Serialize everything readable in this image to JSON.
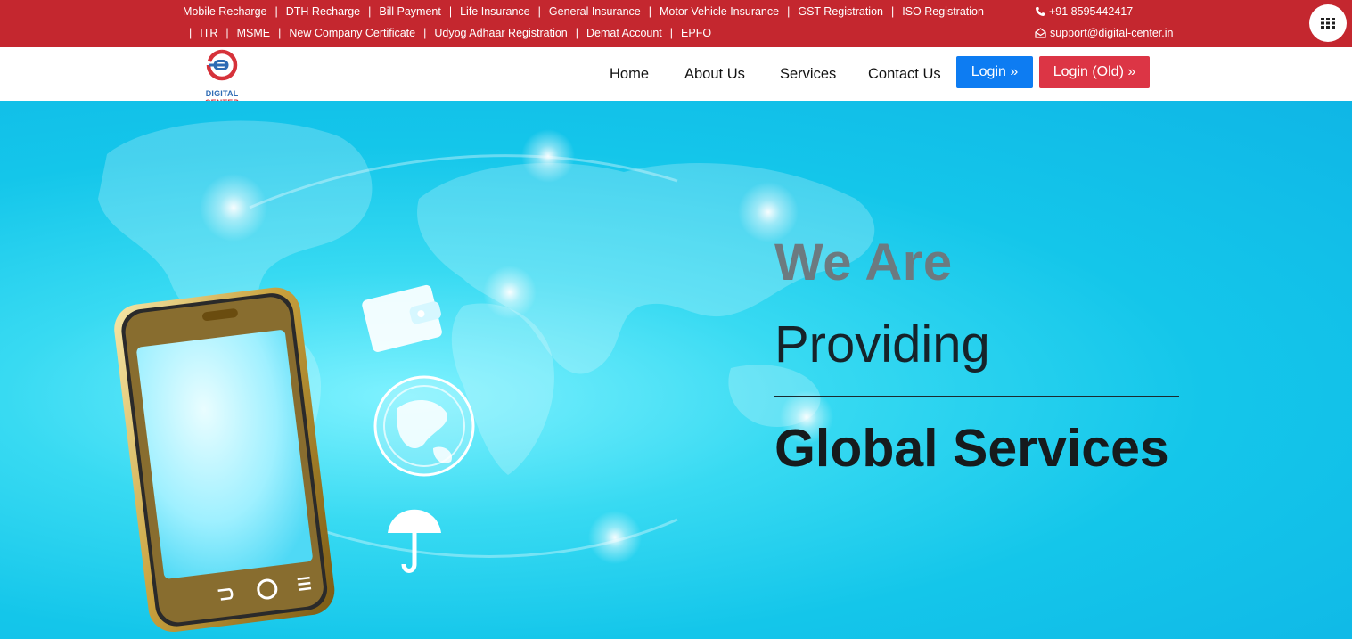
{
  "topbar": {
    "links_row1": [
      "Mobile Recharge",
      "DTH Recharge",
      "Bill Payment",
      "Life Insurance",
      "General Insurance",
      "Motor Vehicle Insurance",
      "GST Registration",
      "ISO Registration"
    ],
    "links_row2": [
      "ITR",
      "MSME",
      "New Company Certificate",
      "Udyog Adhaar Registration",
      "Demat Account",
      "EPFO"
    ],
    "separator": "|",
    "phone": "+91 8595442417",
    "email": "support@digital-center.in",
    "phone_icon": "phone-icon",
    "email_icon": "envelope-icon",
    "menu_icon": "grid-icon"
  },
  "logo": {
    "brand_part1": "DIGITAL",
    "brand_part2": "CENTER"
  },
  "nav": {
    "home": "Home",
    "about": "About Us",
    "services": "Services",
    "contact": "Contact Us",
    "login": "Login »",
    "login_old": "Login (Old) »"
  },
  "hero": {
    "line1": "We Are",
    "line2": "Providing",
    "line3": "Global Services"
  },
  "colors": {
    "topbar": "#c4272f",
    "login_button": "#0d7cf2",
    "login_old_button": "#dc3545",
    "hero_bg": "#14c6ea"
  }
}
